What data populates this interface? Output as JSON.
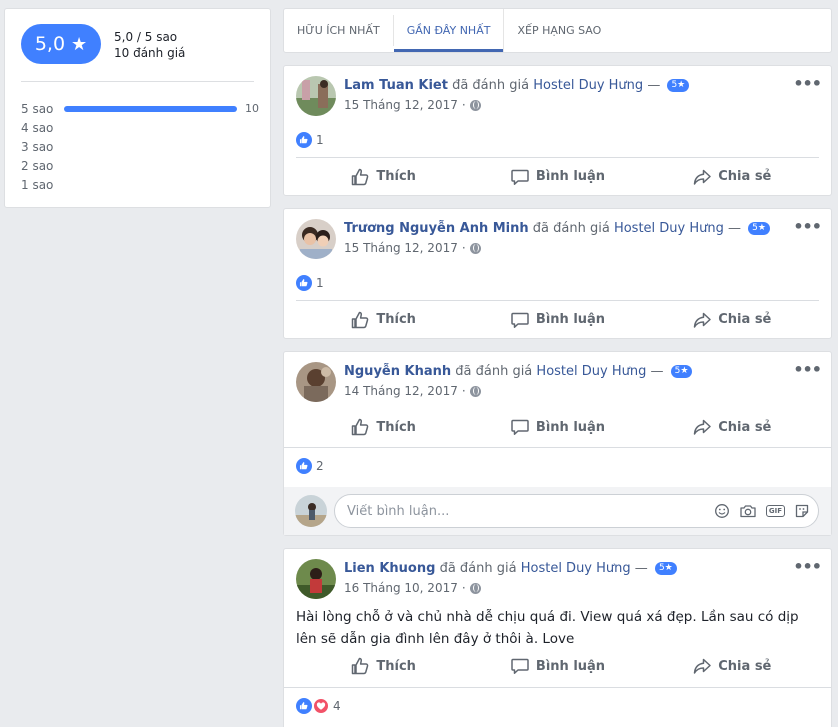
{
  "summary": {
    "score": "5,0",
    "star": "★",
    "score_text": "5,0 / 5 sao",
    "count_text": "10 đánh giá",
    "distribution": [
      {
        "label": "5 sao",
        "count": "10",
        "fraction": 1.0
      },
      {
        "label": "4 sao",
        "count": "",
        "fraction": 0
      },
      {
        "label": "3 sao",
        "count": "",
        "fraction": 0
      },
      {
        "label": "2 sao",
        "count": "",
        "fraction": 0
      },
      {
        "label": "1 sao",
        "count": "",
        "fraction": 0
      }
    ]
  },
  "tabs": [
    {
      "label": "HỮU ÍCH NHẤT",
      "active": false
    },
    {
      "label": "GẦN ĐÂY NHẤT",
      "active": true
    },
    {
      "label": "XẾP HẠNG SAO",
      "active": false
    }
  ],
  "common": {
    "verb": "đã đánh giá",
    "target": "Hostel Duy Hưng",
    "dash": "—",
    "badge": "5★",
    "more": "•••",
    "like": "Thích",
    "comment": "Bình luận",
    "share": "Chia sẻ",
    "comment_placeholder": "Viết bình luận..."
  },
  "posts": [
    {
      "author": "Lam Tuan Kiet",
      "date": "15 Tháng 12, 2017",
      "reactions": "1"
    },
    {
      "author": "Trương Nguyễn Anh Minh",
      "date": "15 Tháng 12, 2017",
      "reactions": "1"
    },
    {
      "author": "Nguyễn Khanh",
      "date": "14 Tháng 12, 2017",
      "reactions": "2"
    },
    {
      "author": "Lien Khuong",
      "date": "16 Tháng 10, 2017",
      "reactions": "4",
      "text": "Hài lòng chỗ ở và chủ nhà dễ chịu quá đi. View quá xá đẹp. Lần sau có dịp lên sẽ dẫn gia đình lên đây ở thôi à. Love"
    }
  ],
  "colors": {
    "accent": "#4080ff",
    "link": "#385898",
    "love": "#f25268"
  }
}
